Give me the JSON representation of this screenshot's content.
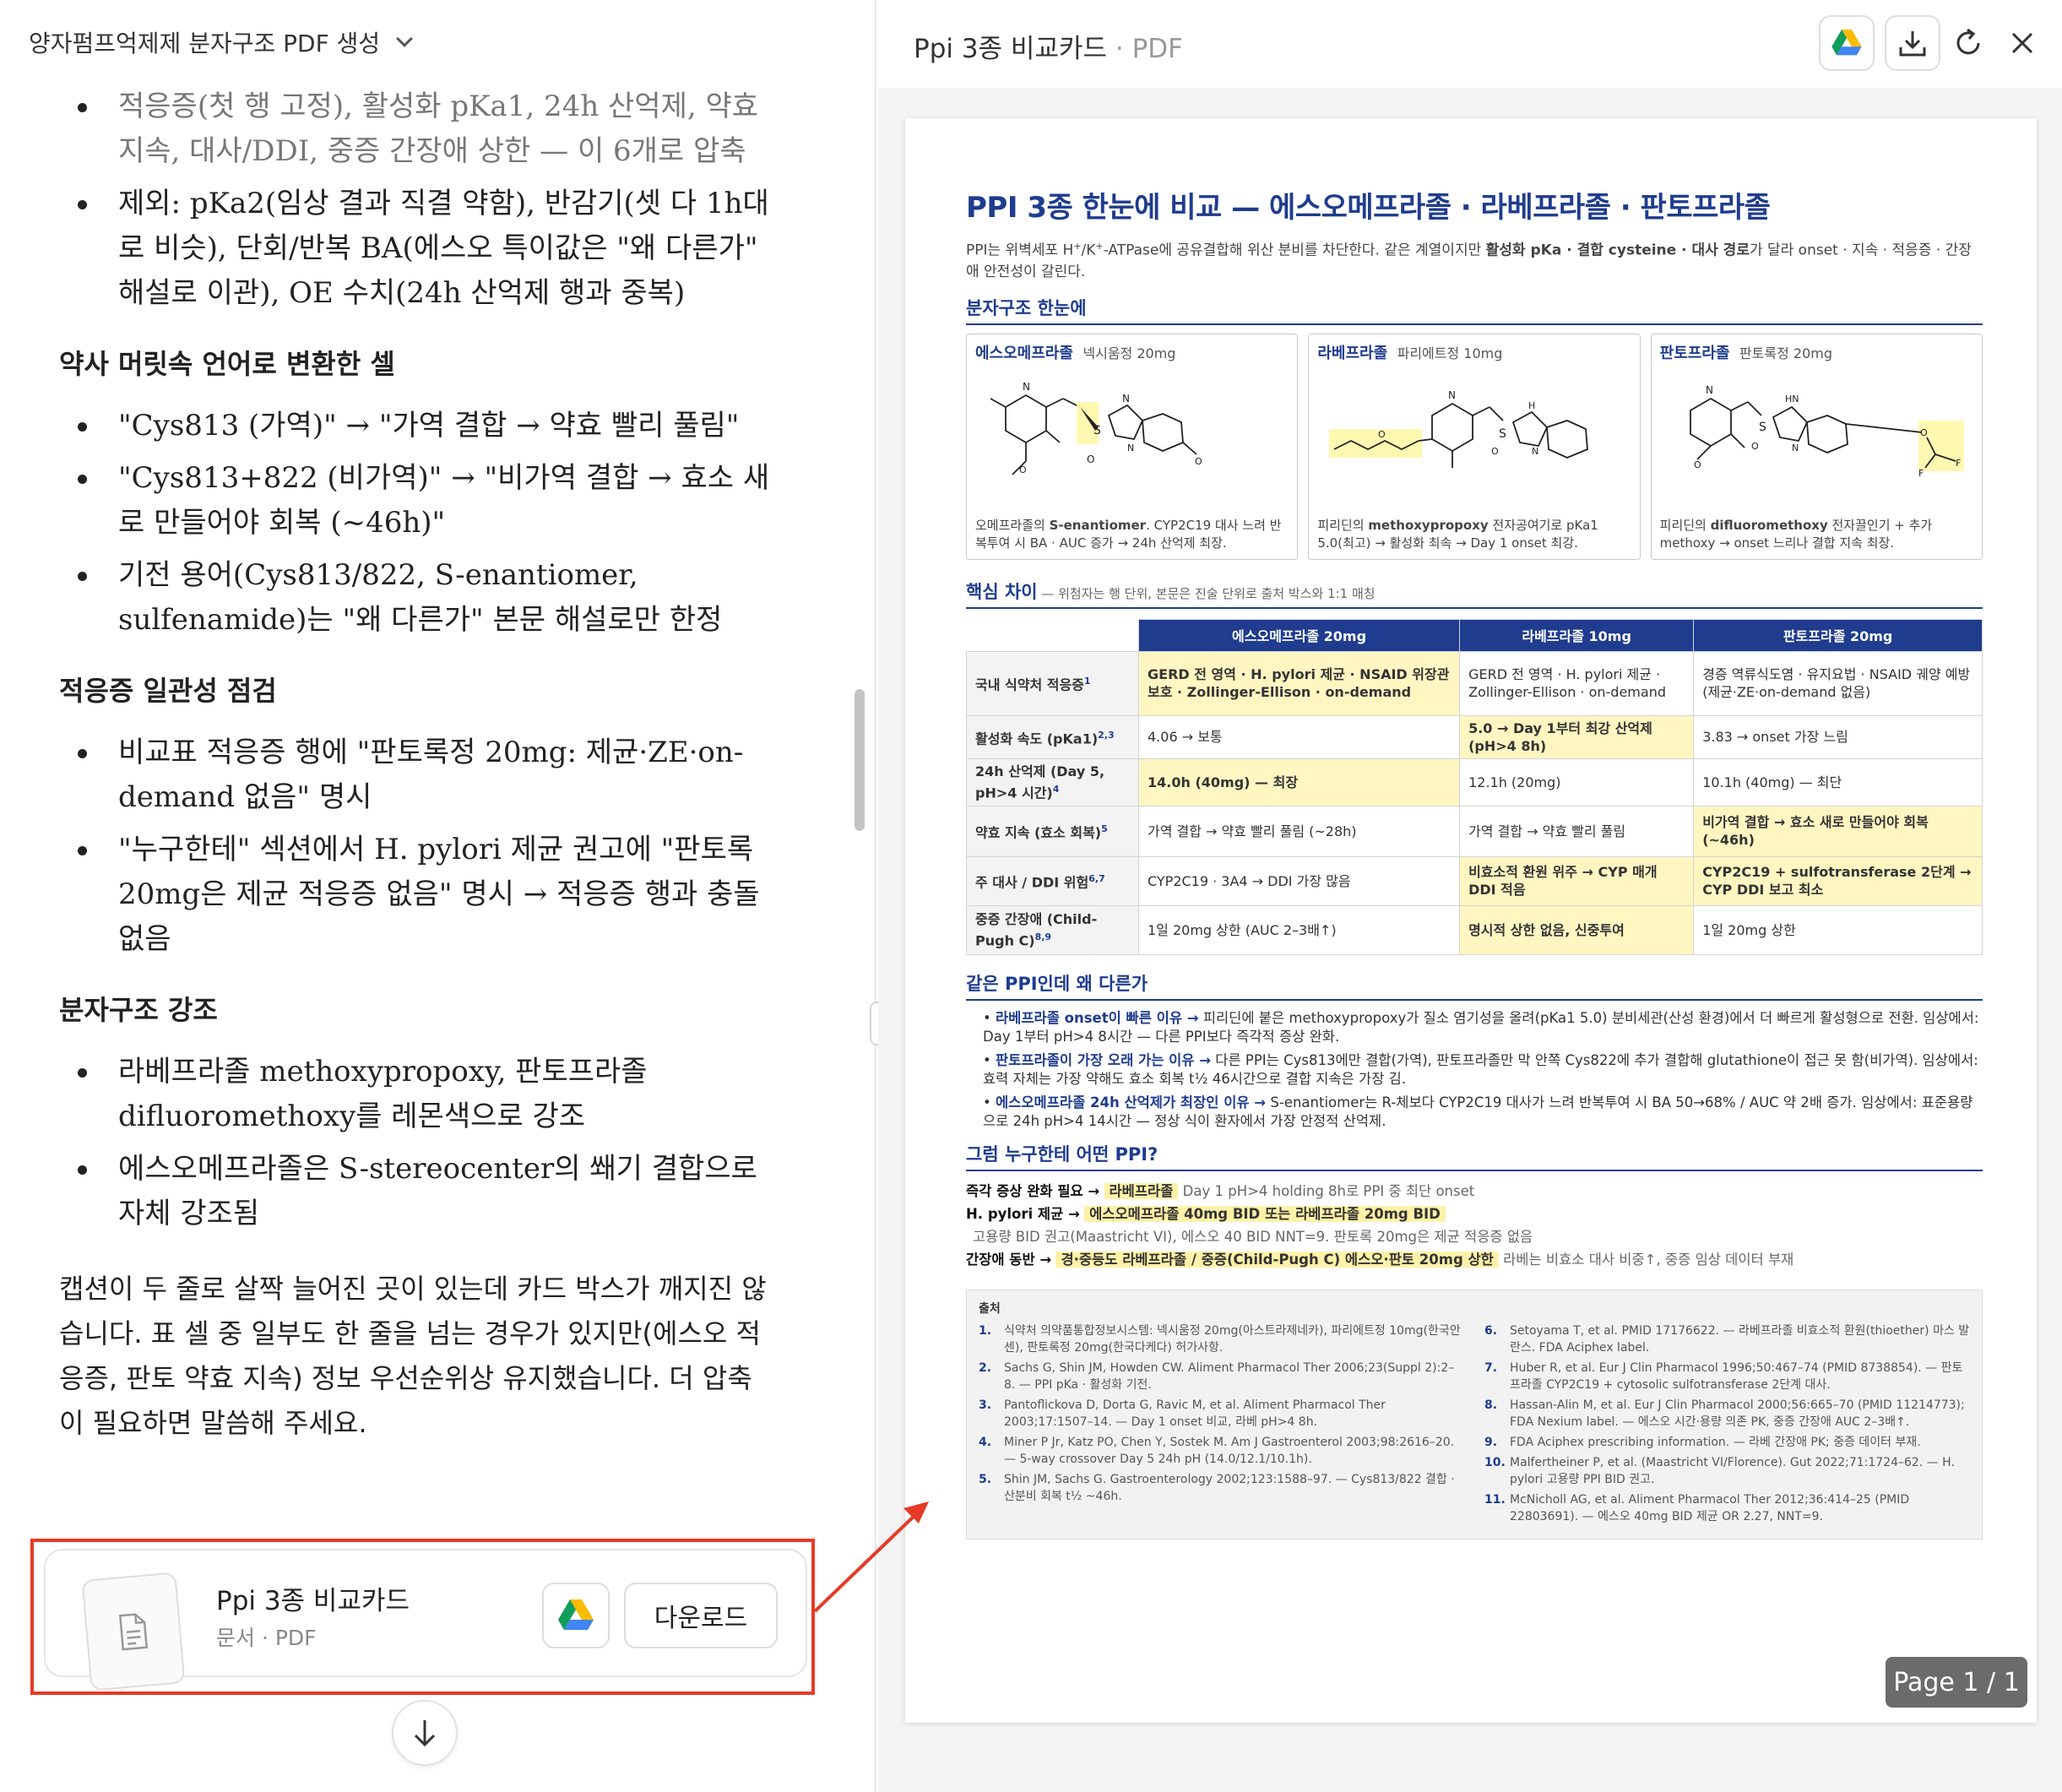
{
  "chat": {
    "title": "양자펌프억제제 분자구조 PDF 생성",
    "bullets_top": [
      "적응증(첫 행 고정), 활성화 pKa1, 24h 산억제, 약효 지속, 대사/DDI, 중증 간장애 상한 — 이 6개로 압축",
      "제외: pKa2(임상 결과 직결 약함), 반감기(셋 다 1h대로 비슷), 단회/반복 BA(에스오 특이값은 \"왜 다른가\" 해설로 이관), OE 수치(24h 산억제 행과 중복)"
    ],
    "section1_title": "약사 머릿속 언어로 변환한 셀",
    "section1_items": [
      "\"Cys813 (가역)\" → \"가역 결합 → 약효 빨리 풀림\"",
      "\"Cys813+822 (비가역)\" → \"비가역 결합 → 효소 새로 만들어야 회복 (~46h)\"",
      "기전 용어(Cys813/822, S-enantiomer, sulfenamide)는 \"왜 다른가\" 본문 해설로만 한정"
    ],
    "section2_title": "적응증 일관성 점검",
    "section2_items": [
      "비교표 적응증 행에 \"판토록정 20mg: 제균·ZE·on-demand 없음\" 명시",
      "\"누구한테\" 섹션에서 H. pylori 제균 권고에 \"판토록 20mg은 제균 적응증 없음\" 명시 → 적응증 행과 충돌 없음"
    ],
    "section3_title": "분자구조 강조",
    "section3_items": [
      "라베프라졸 methoxypropoxy, 판토프라졸 difluoromethoxy를 레몬색으로 강조",
      "에스오메프라졸은 S-stereocenter의 쐐기 결합으로 자체 강조됨"
    ],
    "closing": "캡션이 두 줄로 살짝 늘어진 곳이 있는데 카드 박스가 깨지진 않습니다. 표 셀 중 일부도 한 줄을 넘는 경우가 있지만(에스오 적응증, 판토 약효 지속) 정보 우선순위상 유지했습니다. 더 압축이 필요하면 말씀해 주세요.",
    "attachment": {
      "name": "Ppi 3종 비교카드",
      "meta": "문서 · PDF",
      "download_label": "다운로드"
    }
  },
  "viewer": {
    "title": "Ppi 3종 비교카드",
    "title_suffix": " · PDF",
    "page_indicator": "Page 1 / 1"
  },
  "pdf": {
    "title": "PPI 3종 한눈에 비교 — 에스오메프라졸 · 라베프라졸 · 판토프라졸",
    "lead_a": "PPI는 위벽세포 H",
    "lead_b": "/K",
    "lead_c": "-ATPase에 공유결합해 위산 분비를 차단한다. 같은 계열이지만 ",
    "lead_bold": "활성화 pKa · 결합 cysteine · 대사 경로",
    "lead_d": "가 달라 onset · 지속 · 적응증 · 간장애 안전성이 갈린다.",
    "sec_structure": "분자구조 한눈에",
    "molecules": [
      {
        "name": "에스오메프라졸",
        "product": "넥시움정 20mg",
        "caption_a": "오메프라졸의 ",
        "caption_b": "S-enantiomer",
        "caption_c": ". CYP2C19 대사 느려 반복투여 시 BA · AUC 증가 → 24h 산억제 최장."
      },
      {
        "name": "라베프라졸",
        "product": "파리에트정 10mg",
        "caption_a": "피리딘의 ",
        "caption_b": "methoxypropoxy",
        "caption_c": " 전자공여기로 pKa1 5.0(최고) → 활성화 최속 → Day 1 onset 최강."
      },
      {
        "name": "판토프라졸",
        "product": "판토록정 20mg",
        "caption_a": "피리딘의 ",
        "caption_b": "difluoromethoxy",
        "caption_c": " 전자끌인기 + 추가 methoxy → onset 느리나 결합 지속 최장."
      }
    ],
    "sec_diff": "핵심 차이",
    "sec_diff_note": " — 위첨자는 행 단위, 본문은 진술 단위로 출처 박스와 1:1 매칭",
    "table_headers": [
      "에스오메프라졸 20mg",
      "라베프라졸 10mg",
      "판토프라졸 20mg"
    ],
    "table_rows": [
      {
        "label": "국내 식약처 적응증",
        "sup": "1",
        "cells": [
          "GERD 전 영역 · H. pylori 제균 · NSAID 위장관 보호 · Zollinger-Ellison · on-demand",
          "GERD 전 영역 · H. pylori 제균 · Zollinger-Ellison · on-demand",
          "경증 역류식도염 · 유지요법 · NSAID 궤양 예방 (제균·ZE·on-demand 없음)"
        ]
      },
      {
        "label": "활성화 속도 (pKa1)",
        "sup": "2,3",
        "cells": [
          "4.06 → 보통",
          "5.0 → Day 1부터 최강 산억제 (pH>4 8h)",
          "3.83 → onset 가장 느림"
        ]
      },
      {
        "label": "24h 산억제 (Day 5, pH>4 시간)",
        "sup": "4",
        "cells": [
          "14.0h (40mg) — 최장",
          "12.1h (20mg)",
          "10.1h (40mg) — 최단"
        ]
      },
      {
        "label": "약효 지속 (효소 회복)",
        "sup": "5",
        "cells": [
          "가역 결합 → 약효 빨리 풀림 (~28h)",
          "가역 결합 → 약효 빨리 풀림",
          "비가역 결합 → 효소 새로 만들어야 회복 (~46h)"
        ]
      },
      {
        "label": "주 대사 / DDI 위험",
        "sup": "6,7",
        "cells": [
          "CYP2C19 · 3A4 → DDI 가장 많음",
          "비효소적 환원 위주 → CYP 매개 DDI 적음",
          "CYP2C19 + sulfotransferase 2단계 → CYP DDI 보고 최소"
        ]
      },
      {
        "label": "중증 간장애 (Child-Pugh C)",
        "sup": "8,9",
        "cells": [
          "1일 20mg 상한 (AUC 2–3배↑)",
          "명시적 상한 없음, 신중투여",
          "1일 20mg 상한"
        ]
      }
    ],
    "sec_why": "같은 PPI인데 왜 다른가",
    "why": [
      {
        "head": "라베프라졸 onset이 빠른 이유 →",
        "body": " 피리딘에 붙은 methoxypropoxy가 질소 염기성을 올려(pKa1 5.0) 분비세관(산성 환경)에서 더 빠르게 활성형으로 전환. 임상에서: Day 1부터 pH>4 8시간 — 다른 PPI보다 즉각적 증상 완화."
      },
      {
        "head": "판토프라졸이 가장 오래 가는 이유 →",
        "body": " 다른 PPI는 Cys813에만 결합(가역), 판토프라졸만 막 안쪽 Cys822에 추가 결합해 glutathione이 접근 못 함(비가역). 임상에서: 효력 자체는 가장 약해도 효소 회복 t½ 46시간으로 결합 지속은 가장 김."
      },
      {
        "head": "에스오메프라졸 24h 산억제가 최장인 이유 →",
        "body": " S-enantiomer는 R-체보다 CYP2C19 대사가 느려 반복투여 시 BA 50→68% / AUC 약 2배 증가. 임상에서: 표준용량으로 24h pH>4 14시간 — 정상 식이 환자에서 가장 안정적 산억제."
      }
    ],
    "sec_who": "그럼 누구한테 어떤 PPI?",
    "who": [
      {
        "label": "즉각 증상 완화 필요 →",
        "pick": "라베프라졸",
        "note": "Day 1 pH>4 holding 8h로 PPI 중 최단 onset"
      },
      {
        "label": "H. pylori 제균 →",
        "pick": "에스오메프라졸 40mg BID 또는 라베프라졸 20mg BID",
        "note": ""
      },
      {
        "label": "",
        "pick": "",
        "note": "고용량 BID 권고(Maastricht VI), 에스오 40 BID NNT=9. 판토록 20mg은 제균 적응증 없음"
      },
      {
        "label": "간장애 동반 →",
        "pick": "경·중등도 라베프라졸 / 중증(Child-Pugh C) 에스오·판토 20mg 상한",
        "note": "라베는 비효소 대사 비중↑, 중증 임상 데이터 부재"
      }
    ],
    "refs_title": "출처",
    "refs_left": [
      "식약처 의약품통합정보시스템: 넥시움정 20mg(아스트라제네카), 파리에트정 10mg(한국안센), 판토록정 20mg(한국다케다) 허가사항.",
      "Sachs G, Shin JM, Howden CW. Aliment Pharmacol Ther 2006;23(Suppl 2):2–8. — PPI pKa · 활성화 기전.",
      "Pantoflickova D, Dorta G, Ravic M, et al. Aliment Pharmacol Ther 2003;17:1507–14. — Day 1 onset 비교, 라베 pH>4 8h.",
      "Miner P Jr, Katz PO, Chen Y, Sostek M. Am J Gastroenterol 2003;98:2616–20. — 5-way crossover Day 5 24h pH (14.0/12.1/10.1h).",
      "Shin JM, Sachs G. Gastroenterology 2002;123:1588–97. — Cys813/822 결합 · 산분비 회복 t½ ~46h."
    ],
    "refs_right": [
      "Setoyama T, et al. PMID 17176622. — 라베프라졸 비효소적 환원(thioether) 마스 발란스. FDA Aciphex label.",
      "Huber R, et al. Eur J Clin Pharmacol 1996;50:467–74 (PMID 8738854). — 판토프라졸 CYP2C19 + cytosolic sulfotransferase 2단계 대사.",
      "Hassan-Alin M, et al. Eur J Clin Pharmacol 2000;56:665–70 (PMID 11214773); FDA Nexium label. — 에스오 시간·용량 의존 PK, 중증 간장애 AUC 2–3배↑.",
      "FDA Aciphex prescribing information. — 라베 간장애 PK; 중증 데이터 부재.",
      "Malfertheiner P, et al. (Maastricht VI/Florence). Gut 2022;71:1724–62. — H. pylori 고용량 PPI BID 권고.",
      "McNicholl AG, et al. Aliment Pharmacol Ther 2012;36:414–25 (PMID 22803691). — 에스오 40mg BID 제균 OR 2.27, NNT=9."
    ]
  },
  "colors": {
    "accent": "#1f3c8e",
    "highlight": "#fff6c2",
    "annotation": "#e63a26"
  }
}
